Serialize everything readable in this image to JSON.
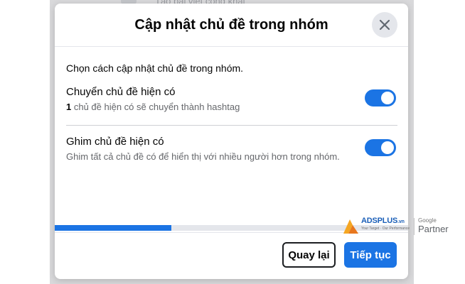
{
  "background": {
    "post_placeholder": "Tạo bài viết công khai"
  },
  "modal": {
    "title": "Cập nhật chủ đề trong nhóm",
    "close_icon": "close-icon",
    "intro": "Chọn cách cập nhật chủ đề trong nhóm.",
    "options": [
      {
        "title": "Chuyển chủ đề hiện có",
        "count": "1",
        "description": " chủ đề hiện có sẽ chuyển thành hashtag",
        "enabled": true
      },
      {
        "title": "Ghim chủ đề hiện có",
        "description": "Ghim tất cả chủ đề có để hiển thị với nhiều người hơn trong nhóm.",
        "enabled": true
      }
    ],
    "progress_fraction": 0.33,
    "back_label": "Quay lại",
    "next_label": "Tiếp tục"
  },
  "watermark": {
    "brand": "ADSPLUS",
    "brand_suffix": ".vn",
    "tagline": "Your Target · Our Performance",
    "google": "Google",
    "partner": "Partner"
  },
  "colors": {
    "accent": "#1b74e4",
    "backdrop": "#d9d9db",
    "text_primary": "#050505",
    "text_secondary": "#65676b"
  }
}
